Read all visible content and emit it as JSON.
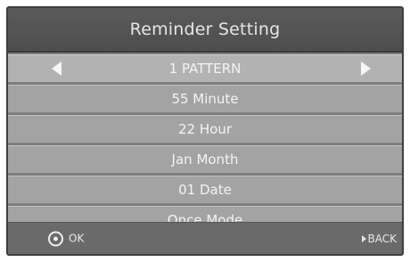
{
  "header": {
    "title": "Reminder  Setting"
  },
  "rows": [
    {
      "label": "1 PATTERN"
    },
    {
      "label": "55 Minute"
    },
    {
      "label": "22 Hour"
    },
    {
      "label": "Jan Month"
    },
    {
      "label": "01 Date"
    },
    {
      "label": "Once Mode"
    }
  ],
  "footer": {
    "ok_label": "OK",
    "ok_icon": "ok-circle-icon",
    "back_label": "BACK",
    "back_icon": "back-arrow-icon"
  },
  "icons": {
    "left": "left-arrow-icon",
    "right": "right-arrow-icon"
  },
  "colors": {
    "title_bg": "#545454",
    "row_bg": "#a3a3a3",
    "selected_row_bg": "#b2b2b2",
    "footer_bg": "#6a6a6a",
    "text": "#f4f4f4"
  }
}
